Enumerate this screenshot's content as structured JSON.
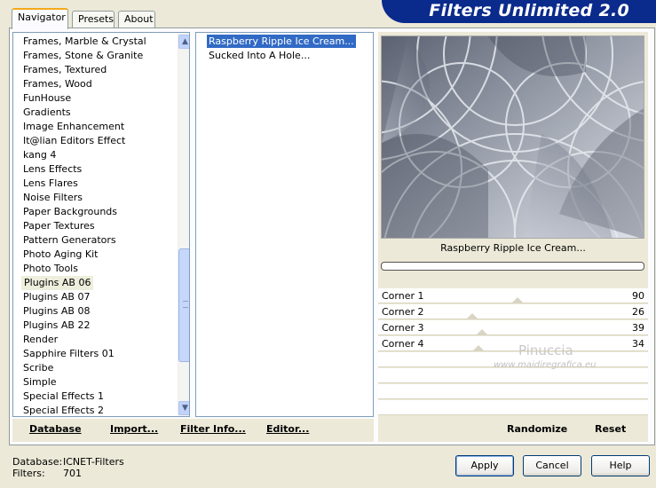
{
  "app": {
    "title": "Filters Unlimited 2.0"
  },
  "tabs": [
    {
      "label": "Navigator"
    },
    {
      "label": "Presets"
    },
    {
      "label": "About"
    }
  ],
  "categories": [
    "Frames, Marble & Crystal",
    "Frames, Stone & Granite",
    "Frames, Textured",
    "Frames, Wood",
    "FunHouse",
    "Gradients",
    "Image Enhancement",
    "It@lian Editors Effect",
    "kang 4",
    "Lens Effects",
    "Lens Flares",
    "Noise Filters",
    "Paper Backgrounds",
    "Paper Textures",
    "Pattern Generators",
    "Photo Aging Kit",
    "Photo Tools",
    "Plugins AB 06",
    "Plugins AB 07",
    "Plugins AB 08",
    "Plugins AB 22",
    "Render",
    "Sapphire Filters 01",
    "Scribe",
    "Simple",
    "Special Effects 1",
    "Special Effects 2"
  ],
  "selected_category": "Plugins AB 06",
  "filters": [
    "Raspberry Ripple Ice Cream...",
    "Sucked Into A Hole..."
  ],
  "selected_filter": "Raspberry Ripple Ice Cream...",
  "preview": {
    "filter_name": "Raspberry Ripple Ice Cream..."
  },
  "parameters": [
    {
      "label": "Corner 1",
      "value": "90"
    },
    {
      "label": "Corner 2",
      "value": "26"
    },
    {
      "label": "Corner 3",
      "value": "39"
    },
    {
      "label": "Corner 4",
      "value": "34"
    }
  ],
  "toolbar": {
    "database": "Database",
    "import": "Import...",
    "filter_info": "Filter Info...",
    "editor": "Editor...",
    "randomize": "Randomize",
    "reset": "Reset"
  },
  "status": {
    "database_label": "Database:",
    "database_value": "ICNET-Filters",
    "filters_label": "Filters:",
    "filters_value": "701"
  },
  "buttons": {
    "apply": "Apply",
    "cancel": "Cancel",
    "help": "Help"
  },
  "watermark": {
    "name": "Pinuccia",
    "site": "www.maidiregrafica.eu"
  },
  "colors": {
    "banner": "#0a2a8c",
    "selection": "#316ac5",
    "tab_accent": "#f3a91c"
  }
}
